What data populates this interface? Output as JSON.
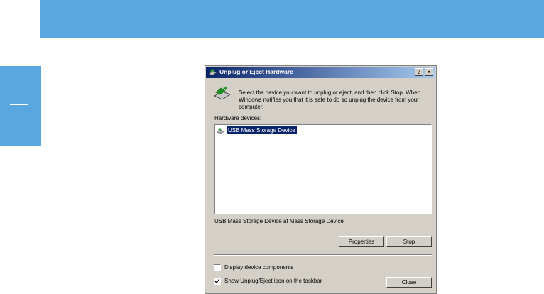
{
  "colors": {
    "accent_band": "#5aa7df",
    "titlebar_start": "#0a246a",
    "titlebar_end": "#a6caf0",
    "dialog_bg": "#d4d0c8",
    "selection": "#0a246a"
  },
  "dialog": {
    "title": "Unplug or Eject Hardware",
    "help_button": "?",
    "close_button": "×",
    "instructions": "Select the device you want to unplug or eject, and then click Stop. When Windows notifies you that it is safe to do so unplug the device from your computer.",
    "hardware_label": "Hardware devices:",
    "devices": [
      {
        "label": "USB Mass Storage Device",
        "icon": "usb-storage-icon",
        "selected": true
      }
    ],
    "device_description": "USB Mass Storage Device at Mass Storage Device",
    "properties_label": "Properties",
    "stop_label": "Stop",
    "display_components_label": "Display device components",
    "display_components_checked": false,
    "show_icon_label": "Show Unplug/Eject icon on the taskbar",
    "show_icon_checked": true,
    "close_label": "Close"
  }
}
